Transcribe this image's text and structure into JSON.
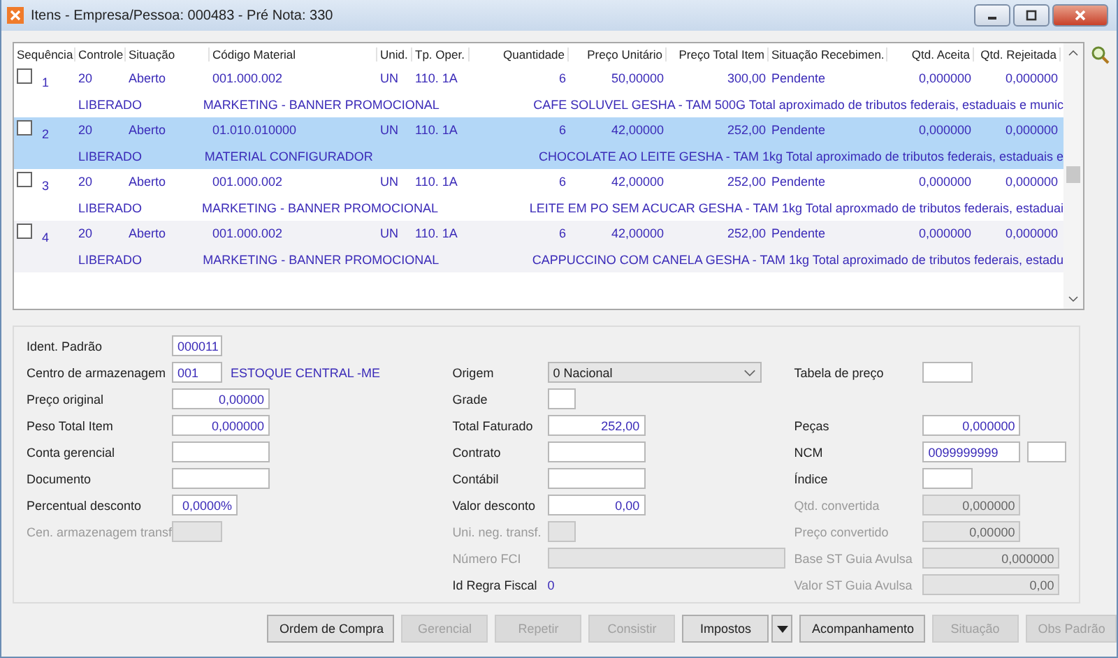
{
  "window": {
    "title": "Itens - Empresa/Pessoa: 000483 - Pré Nota: 330"
  },
  "table": {
    "columns": [
      "Sequência",
      "Controle",
      "Situação",
      "Código Material",
      "Unid.",
      "Tp. Oper.",
      "Quantidade",
      "Preço Unitário",
      "Preço Total Item",
      "Situação Recebimen.",
      "Qtd. Aceita",
      "Qtd. Rejeitada"
    ],
    "rows": [
      {
        "checked": false,
        "selected": false,
        "cells": [
          "1",
          "20",
          "Aberto",
          "001.000.002",
          "UN",
          "110. 1A",
          "6",
          "50,00000",
          "300,00",
          "Pendente",
          "0,000000",
          "0,000000"
        ],
        "status": "LIBERADO",
        "material": "MARKETING - BANNER PROMOCIONAL",
        "description": "CAFE SOLUVEL GESHA - TAM 500G Total aproximado de tributos federais, estaduais e munic"
      },
      {
        "checked": false,
        "selected": true,
        "cells": [
          "2",
          "20",
          "Aberto",
          "01.010.010000",
          "UN",
          "110. 1A",
          "6",
          "42,00000",
          "252,00",
          "Pendente",
          "0,000000",
          "0,000000"
        ],
        "status": "LIBERADO",
        "material": "MATERIAL CONFIGURADOR",
        "description": "CHOCOLATE AO LEITE GESHA - TAM 1kg Total aproximado de tributos federais, estaduais e"
      },
      {
        "checked": false,
        "selected": false,
        "cells": [
          "3",
          "20",
          "Aberto",
          "001.000.002",
          "UN",
          "110. 1A",
          "6",
          "42,00000",
          "252,00",
          "Pendente",
          "0,000000",
          "0,000000"
        ],
        "status": "LIBERADO",
        "material": "MARKETING - BANNER PROMOCIONAL",
        "description": "LEITE EM PO SEM ACUCAR GESHA - TAM 1kg Total aproxmado de tributos federais, estaduai"
      },
      {
        "checked": false,
        "selected": false,
        "cells": [
          "4",
          "20",
          "Aberto",
          "001.000.002",
          "UN",
          "110. 1A",
          "6",
          "42,00000",
          "252,00",
          "Pendente",
          "0,000000",
          "0,000000"
        ],
        "status": "LIBERADO",
        "material": "MARKETING - BANNER PROMOCIONAL",
        "description": "CAPPUCCINO COM CANELA GESHA - TAM 1kg Total aproximado de tributos federais, estadu"
      }
    ]
  },
  "form": {
    "columns": [
      [
        {
          "kind": "input",
          "label": "Ident. Padrão",
          "value": "000011",
          "disabled": false
        },
        {
          "kind": "input",
          "label": "Centro de armazenagem",
          "value": "001",
          "disabled": false,
          "note": "ESTOQUE CENTRAL -ME"
        },
        {
          "kind": "number",
          "label": "Preço original",
          "value": "0,00000",
          "disabled": false
        },
        {
          "kind": "number",
          "label": "Peso Total Item",
          "value": "0,000000",
          "disabled": false
        },
        {
          "kind": "input",
          "label": "Conta gerencial",
          "disabled": false
        },
        {
          "kind": "input",
          "label": "Documento",
          "disabled": false
        },
        {
          "kind": "number",
          "label": "Percentual desconto",
          "value": "0,0000%",
          "disabled": false
        },
        {
          "kind": "input",
          "label": "Cen. armazenagem transf",
          "disabled": true
        }
      ],
      [
        {
          "kind": "blank"
        },
        {
          "kind": "select",
          "label": "Origem",
          "value": "0 Nacional"
        },
        {
          "kind": "input",
          "label": "Grade",
          "disabled": false
        },
        {
          "kind": "number",
          "label": "Total Faturado",
          "value": "252,00",
          "disabled": false
        },
        {
          "kind": "input",
          "label": "Contrato",
          "disabled": false
        },
        {
          "kind": "input",
          "label": "Contábil",
          "disabled": false
        },
        {
          "kind": "number",
          "label": "Valor desconto",
          "value": "0,00",
          "disabled": false
        },
        {
          "kind": "input",
          "label": "Uni. neg. transf.",
          "disabled": true
        },
        {
          "kind": "input",
          "label": "Número FCI",
          "disabled": true
        },
        {
          "kind": "text",
          "label": "Id Regra Fiscal",
          "value": "0"
        }
      ],
      [
        {
          "kind": "blank"
        },
        {
          "kind": "input",
          "label": "Tabela de preço",
          "disabled": false
        },
        {
          "kind": "blank"
        },
        {
          "kind": "number",
          "label": "Peças",
          "value": "0,000000",
          "disabled": false
        },
        {
          "kind": "input",
          "label": "NCM",
          "value": "0099999999",
          "disabled": false,
          "extra_field": true
        },
        {
          "kind": "input",
          "label": "Índice",
          "disabled": false
        },
        {
          "kind": "number",
          "label": "Qtd. convertida",
          "value": "0,000000",
          "disabled": true
        },
        {
          "kind": "number",
          "label": "Preço convertido",
          "value": "0,00000",
          "disabled": true
        },
        {
          "kind": "number",
          "label": "Base ST Guia Avulsa",
          "value": "0,000000",
          "disabled": true
        },
        {
          "kind": "number",
          "label": "Valor ST Guia Avulsa",
          "value": "0,00",
          "disabled": true
        }
      ]
    ]
  },
  "buttons": [
    {
      "label": "Ordem de Compra",
      "disabled": false
    },
    {
      "label": "Gerencial",
      "disabled": true
    },
    {
      "label": "Repetir",
      "disabled": true
    },
    {
      "label": "Consistir",
      "disabled": true
    },
    {
      "label": "Impostos",
      "disabled": false,
      "dropdown": true
    },
    {
      "label": "Acompanhamento",
      "disabled": false
    },
    {
      "label": "Situação",
      "disabled": true
    },
    {
      "label": "Obs Padrão",
      "disabled": true
    }
  ]
}
